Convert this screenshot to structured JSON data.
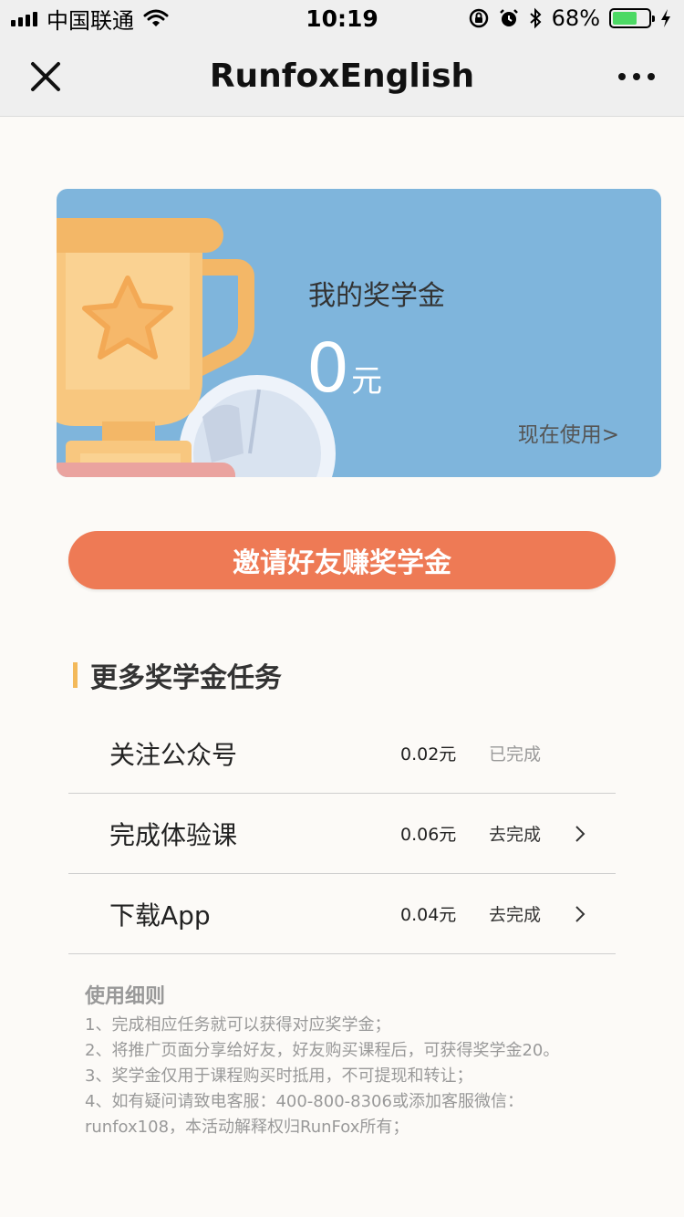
{
  "status_bar": {
    "carrier": "中国联通",
    "time": "10:19",
    "battery": "68%",
    "battery_level": 0.68
  },
  "nav": {
    "title": "RunfoxEnglish",
    "close_icon": "close-icon",
    "more_icon": "more-icon"
  },
  "card": {
    "title": "我的奖学金",
    "amount": "0",
    "unit": "元",
    "use_link": "现在使用>"
  },
  "invite_button": "邀请好友赚奖学金",
  "section": {
    "title": "更多奖学金任务"
  },
  "tasks": [
    {
      "name": "关注公众号",
      "reward": "0.02元",
      "status": "已完成"
    },
    {
      "name": "完成体验课",
      "reward": "0.06元",
      "status": "去完成"
    },
    {
      "name": "下载App",
      "reward": "0.04元",
      "status": "去完成"
    }
  ],
  "rules": {
    "title": "使用细则",
    "items": [
      "1、完成相应任务就可以获得对应奖学金；",
      "2、将推广页面分享给好友，好友购买课程后，可获得奖学金20。",
      "3、奖学金仅用于课程购买时抵用，不可提现和转让；",
      "4、如有疑问请致电客服：400-800-8306或添加客服微信：runfox108，本活动解释权归RunFox所有；"
    ]
  },
  "colors": {
    "card_bg": "#7fb5dc",
    "accent_orange": "#ee7a55",
    "section_bar": "#f3b95a",
    "trophy": "#f3b767"
  }
}
